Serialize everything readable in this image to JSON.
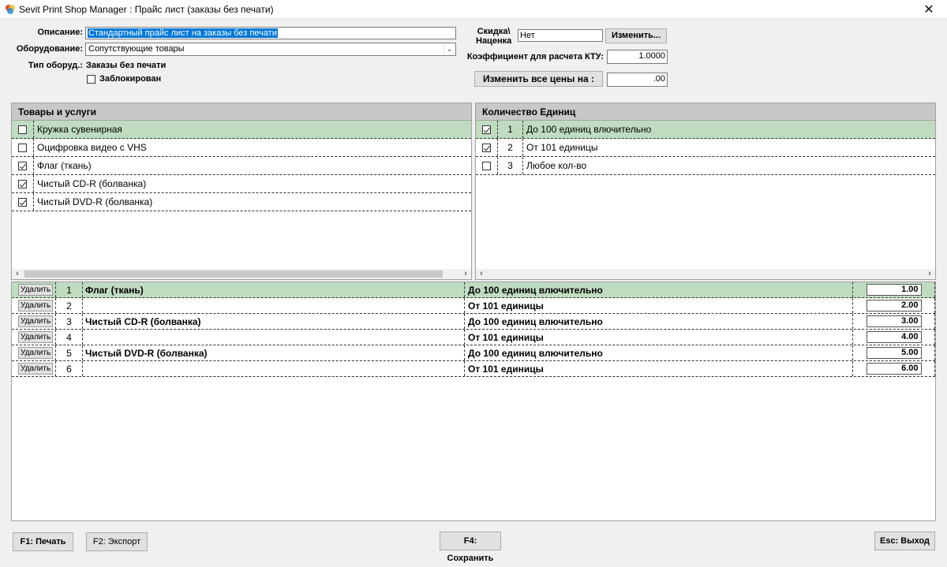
{
  "window": {
    "title": "Sevit Print Shop Manager : Прайс лист (заказы без печати)",
    "close_glyph": "✕"
  },
  "form": {
    "description_label": "Описание:",
    "description_value": "Стандартный прайс лист на заказы без печати",
    "equipment_label": "Оборудование:",
    "equipment_value": "Сопутствующие товары",
    "equipment_type_label": "Тип оборуд.:",
    "equipment_type_value": "Заказы без печати",
    "blocked_label": "Заблокирован",
    "blocked_checked": false,
    "discount_label_line1": "Скидка\\",
    "discount_label_line2": "Наценка",
    "discount_value": "Нет",
    "change_button": "Изменить...",
    "kt_label": "Коэффициент для расчета КТУ:",
    "kt_value": "1.0000",
    "change_all_button": "Изменить все цены на :",
    "change_all_value": ".00"
  },
  "goods_panel": {
    "header": "Товары и услуги",
    "items": [
      {
        "label": "Кружка сувенирная",
        "checked": false,
        "selected": true
      },
      {
        "label": "Оцифровка видео с VHS",
        "checked": false,
        "selected": false
      },
      {
        "label": "Флаг (ткань)",
        "checked": true,
        "selected": false
      },
      {
        "label": "Чистый CD-R (болванка)",
        "checked": true,
        "selected": false
      },
      {
        "label": "Чистый DVD-R (болванка)",
        "checked": true,
        "selected": false
      }
    ]
  },
  "units_panel": {
    "header": "Количество Единиц",
    "items": [
      {
        "num": "1",
        "label": "До 100 единиц влючительно",
        "checked": true,
        "selected": true
      },
      {
        "num": "2",
        "label": "От 101 единицы",
        "checked": true,
        "selected": false
      },
      {
        "num": "3",
        "label": "Любое кол-во",
        "checked": false,
        "selected": false
      }
    ]
  },
  "price_grid": {
    "delete_label": "Удалить",
    "rows": [
      {
        "num": "1",
        "product": "Флаг (ткань)",
        "qty": "До 100 единиц влючительно",
        "price": "1.00",
        "selected": true
      },
      {
        "num": "2",
        "product": "",
        "qty": "От 101 единицы",
        "price": "2.00",
        "selected": false
      },
      {
        "num": "3",
        "product": "Чистый CD-R (болванка)",
        "qty": "До 100 единиц влючительно",
        "price": "3.00",
        "selected": false
      },
      {
        "num": "4",
        "product": "",
        "qty": "От 101 единицы",
        "price": "4.00",
        "selected": false
      },
      {
        "num": "5",
        "product": "Чистый DVD-R (болванка)",
        "qty": "До 100 единиц влючительно",
        "price": "5.00",
        "selected": false
      },
      {
        "num": "6",
        "product": "",
        "qty": "От 101 единицы",
        "price": "6.00",
        "selected": false
      }
    ]
  },
  "footer": {
    "print_button": "F1: Печать",
    "export_button": "F2: Экспорт",
    "save_button": "F4: Сохранить",
    "exit_button": "Esc: Выход"
  },
  "colors": {
    "selection_row": "#c0dcc0",
    "text_selection": "#0078d7",
    "header_bg": "#c8c8c8"
  }
}
